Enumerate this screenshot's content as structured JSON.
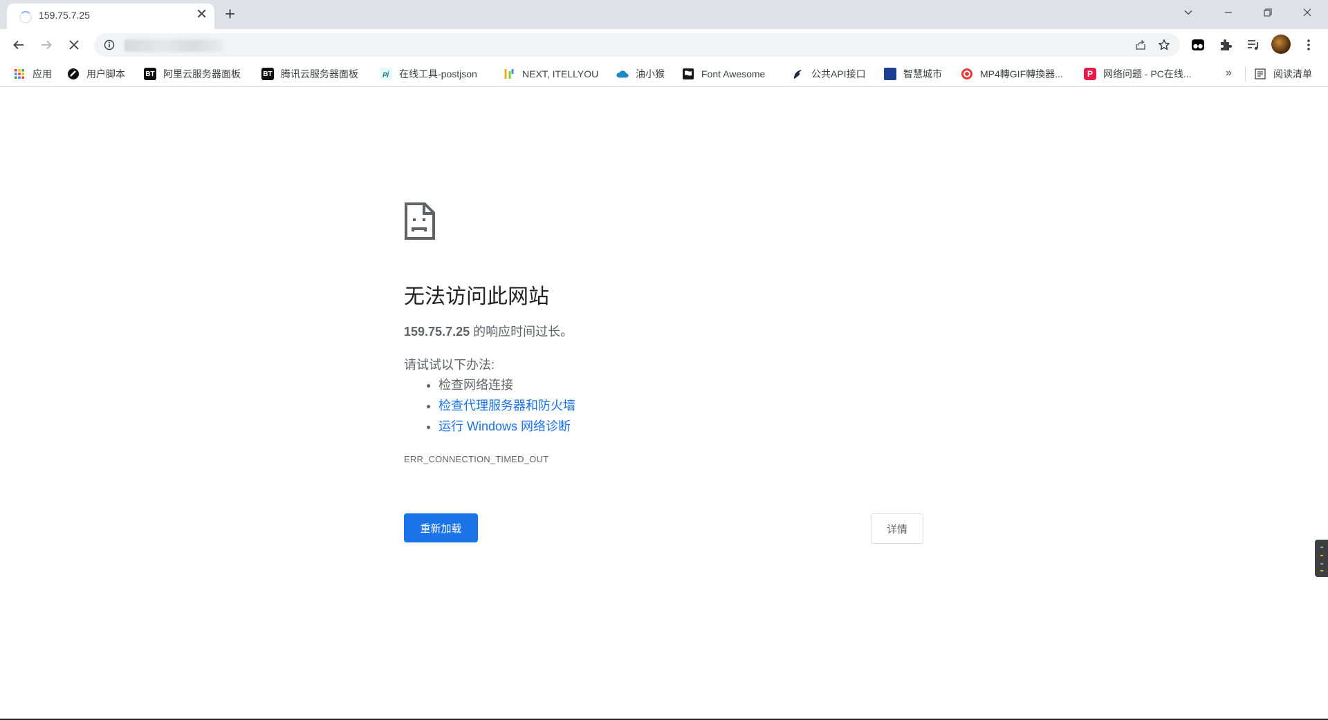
{
  "tab": {
    "title": "159.75.7.25",
    "close_glyph": "✕"
  },
  "new_tab_glyph": "+",
  "window_controls": [
    "chevron-down-icon",
    "minimize-icon",
    "restore-icon",
    "close-icon"
  ],
  "toolbar": {
    "back": "back-arrow-icon",
    "forward": "forward-arrow-icon",
    "stop": "stop-icon",
    "address_value": ""
  },
  "bookmarks": {
    "items": [
      {
        "label": "应用",
        "icon": "apps-grid-icon"
      },
      {
        "label": "用户脚本",
        "icon": "userscript-icon"
      },
      {
        "label": "阿里云服务器面板",
        "icon_text": "BT"
      },
      {
        "label": "腾讯云服务器面板",
        "icon_text": "BT"
      },
      {
        "label": "在线工具-postjson",
        "icon_text": "pj"
      },
      {
        "label": "NEXT, ITELLYOU",
        "icon": "itellyou-icon"
      },
      {
        "label": "油小猴",
        "icon": "cloud-icon"
      },
      {
        "label": "Font Awesome",
        "icon": "flag-icon"
      },
      {
        "label": "公共API接口",
        "icon": "api-icon"
      },
      {
        "label": "智慧城市",
        "icon": "city-icon"
      },
      {
        "label": "MP4轉GIF轉換器...",
        "icon": "convert-icon"
      },
      {
        "label": "网络问题 - PC在线...",
        "icon_text": "P"
      }
    ],
    "more_glyph": "»",
    "reading_list": "阅读清单"
  },
  "error": {
    "title": "无法访问此网站",
    "host": "159.75.7.25",
    "desc_suffix": " 的响应时间过长。",
    "try_label": "请试试以下办法:",
    "suggestions": [
      {
        "text": "检查网络连接",
        "link": false
      },
      {
        "text": "检查代理服务器和防火墙",
        "link": true
      },
      {
        "text": "运行 Windows 网络诊断",
        "link": true
      }
    ],
    "code": "ERR_CONNECTION_TIMED_OUT",
    "reload_label": "重新加载",
    "details_label": "详情"
  },
  "colors": {
    "accent": "#1a73e8",
    "tabstrip": "#dee1e6",
    "text_secondary": "#5f6368"
  }
}
